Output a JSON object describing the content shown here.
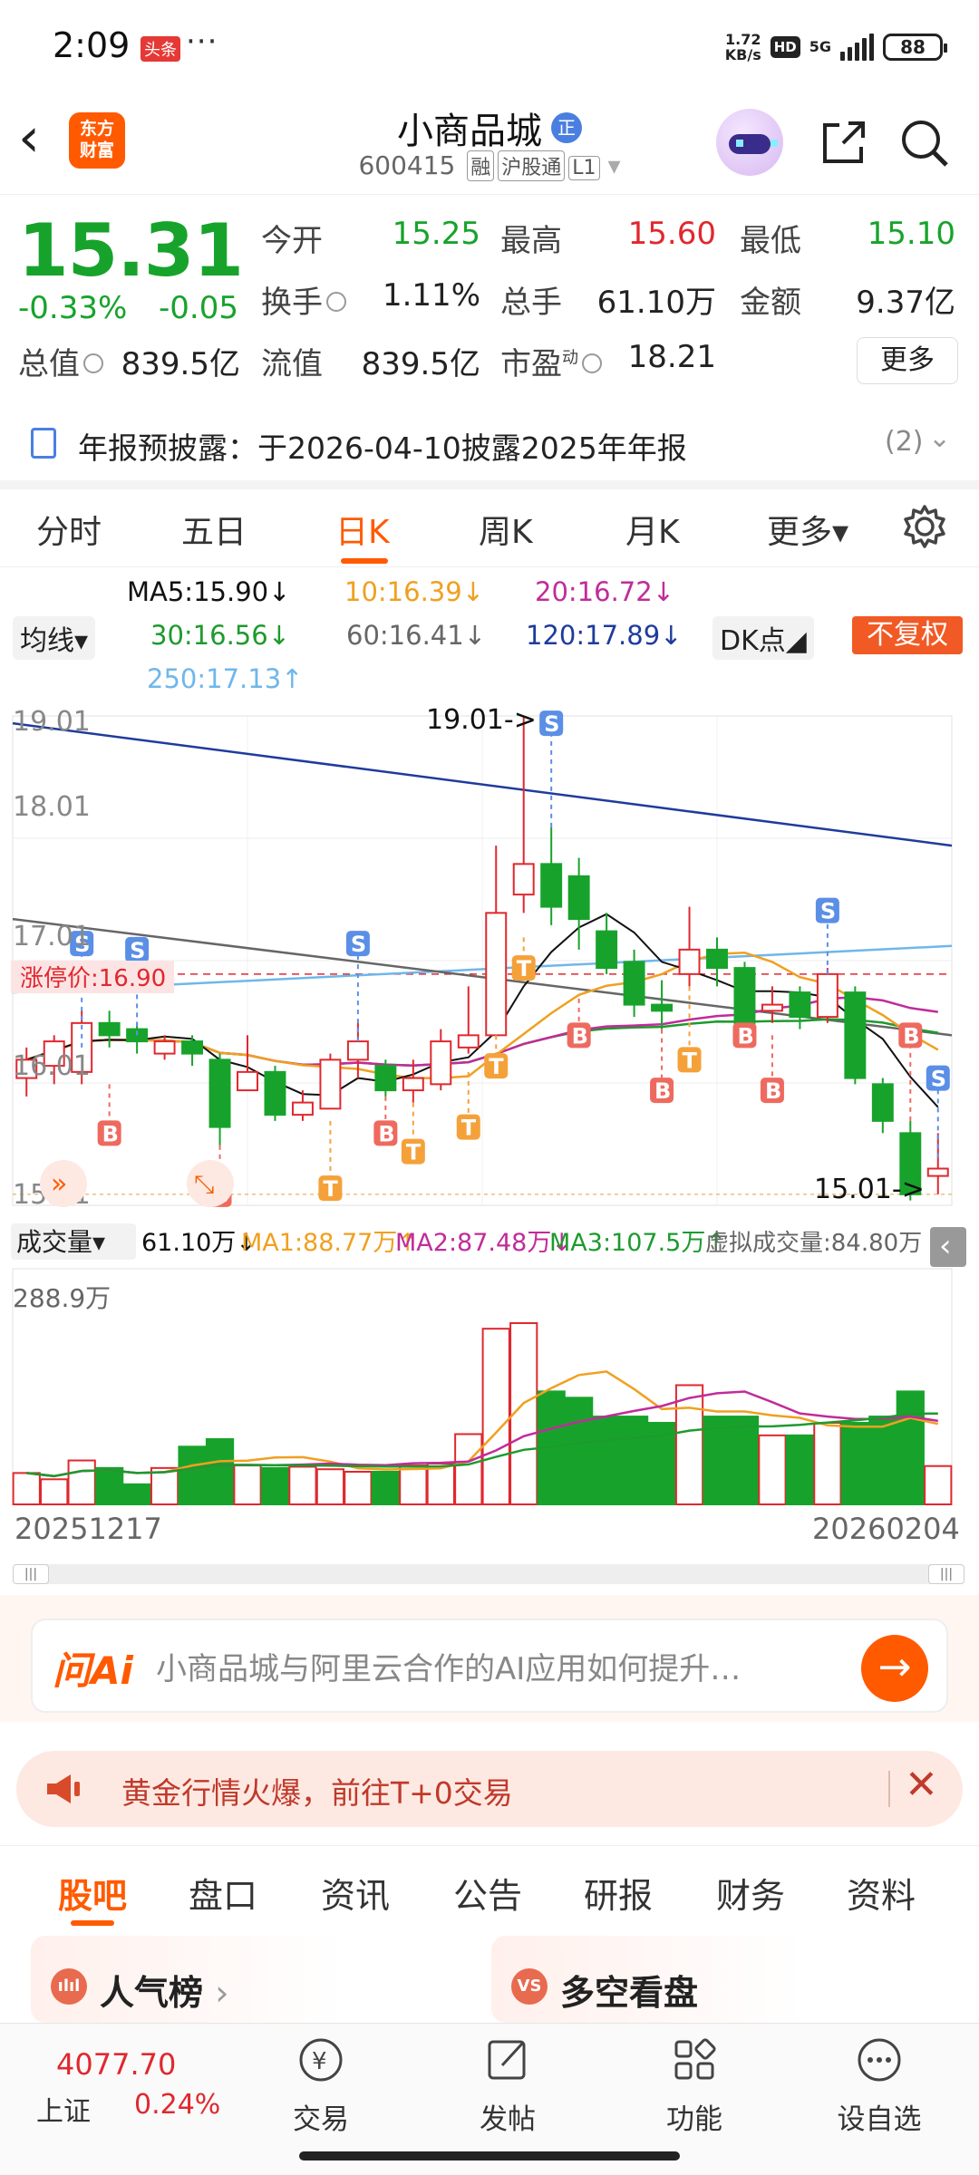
{
  "status_bar": {
    "time": "2:09",
    "app_badge": "头条",
    "dots": "···",
    "net_speed_value": "1.72",
    "net_speed_unit": "KB/s",
    "hd": "HD",
    "signal": "5G",
    "battery": "88"
  },
  "header": {
    "back": "‹",
    "logo_line1": "东方",
    "logo_line2": "财富",
    "stock_name": "小商品城",
    "name_badge": "正",
    "code": "600415",
    "tags": [
      "融",
      "沪股通",
      "L1"
    ],
    "dropdown": "▾"
  },
  "quote": {
    "price": "15.31",
    "change_pct": "-0.33%",
    "change": "-0.05",
    "open_label": "今开",
    "open": "15.25",
    "high_label": "最高",
    "high": "15.60",
    "low_label": "最低",
    "low": "15.10",
    "turnover_label": "换手",
    "turnover": "1.11%",
    "volume_label": "总手",
    "volume": "61.10万",
    "amount_label": "金额",
    "amount": "9.37亿",
    "mktcap_label": "总值",
    "mktcap": "839.5亿",
    "float_label": "流值",
    "float": "839.5亿",
    "pe_label": "市盈",
    "pe_sup": "动",
    "pe": "18.21",
    "more": "更多"
  },
  "notice": {
    "text": "年报预披露：于2026-04-10披露2025年年报",
    "count": "(2)",
    "chevron": "⌄"
  },
  "period_tabs": [
    "分时",
    "五日",
    "日K",
    "周K",
    "月K",
    "更多▾"
  ],
  "active_period": "日K",
  "ma": {
    "ma5": "MA5:15.90↓",
    "ma10": "10:16.39↓",
    "ma20": "20:16.72↓",
    "ma30": "30:16.56↓",
    "ma60": "60:16.41↓",
    "ma120": "120:17.89↓",
    "ma250": "250:17.13↑",
    "junxian": "均线▾",
    "dk": "DK点◢",
    "nofq": "不复权"
  },
  "colors": {
    "up": "#e0282e",
    "down": "#17a32b",
    "accent": "#ff5a00",
    "ma5": "#111111",
    "ma10": "#f0a020",
    "ma20": "#c02c9a",
    "ma30": "#1e9a2e",
    "ma60": "#666666",
    "ma120": "#1f3b9c",
    "ma250": "#6fb7ea"
  },
  "chart_labels": {
    "y_top": "19.01",
    "y_18": "18.01",
    "y_17": "17.01",
    "y_16": "16.01",
    "y_bottom": "15.01",
    "high_arrow": "19.01->",
    "low_arrow": "15.01->",
    "limit_price": "涨停价:16.90",
    "vol_title": "成交量▾",
    "vol_value": "61.10万↓",
    "vol_ma1": "MA1:88.77万↑",
    "vol_ma2": "MA2:87.48万↓",
    "vol_ma3": "MA3:107.5万↑",
    "vol_virtual": "虚拟成交量:84.80万",
    "vol_max": "288.9万",
    "date_start": "20251217",
    "date_end": "20260204",
    "collapse": "‹"
  },
  "chart_data": {
    "type": "candlestick",
    "x_start": "20251217",
    "x_end": "20260204",
    "ylim": [
      15.01,
      19.01
    ],
    "yticks": [
      "19.01",
      "18.01",
      "17.01",
      "16.01",
      "15.01"
    ],
    "candles": [
      {
        "o": 16.05,
        "c": 16.2,
        "h": 16.3,
        "l": 15.9
      },
      {
        "o": 16.15,
        "c": 16.35,
        "h": 16.4,
        "l": 16.0
      },
      {
        "o": 16.1,
        "c": 16.5,
        "h": 16.6,
        "l": 16.0
      },
      {
        "o": 16.5,
        "c": 16.4,
        "h": 16.6,
        "l": 16.3
      },
      {
        "o": 16.45,
        "c": 16.35,
        "h": 16.5,
        "l": 16.25
      },
      {
        "o": 16.25,
        "c": 16.35,
        "h": 16.4,
        "l": 16.2
      },
      {
        "o": 16.35,
        "c": 16.25,
        "h": 16.4,
        "l": 16.15
      },
      {
        "o": 16.2,
        "c": 15.65,
        "h": 16.25,
        "l": 15.5
      },
      {
        "o": 15.95,
        "c": 16.1,
        "h": 16.4,
        "l": 15.95
      },
      {
        "o": 16.1,
        "c": 15.75,
        "h": 16.15,
        "l": 15.7
      },
      {
        "o": 15.75,
        "c": 15.85,
        "h": 15.95,
        "l": 15.7
      },
      {
        "o": 15.8,
        "c": 16.2,
        "h": 16.25,
        "l": 15.8
      },
      {
        "o": 16.2,
        "c": 16.35,
        "h": 16.5,
        "l": 16.05
      },
      {
        "o": 16.15,
        "c": 15.95,
        "h": 16.2,
        "l": 15.9
      },
      {
        "o": 15.95,
        "c": 16.05,
        "h": 16.2,
        "l": 15.85
      },
      {
        "o": 16.0,
        "c": 16.35,
        "h": 16.45,
        "l": 15.95
      },
      {
        "o": 16.3,
        "c": 16.4,
        "h": 16.8,
        "l": 16.25
      },
      {
        "o": 16.4,
        "c": 17.4,
        "h": 17.95,
        "l": 16.4
      },
      {
        "o": 17.55,
        "c": 17.8,
        "h": 19.01,
        "l": 17.4
      },
      {
        "o": 17.8,
        "c": 17.45,
        "h": 18.1,
        "l": 17.3
      },
      {
        "o": 17.7,
        "c": 17.35,
        "h": 17.85,
        "l": 17.1
      },
      {
        "o": 17.25,
        "c": 16.95,
        "h": 17.4,
        "l": 16.9
      },
      {
        "o": 17.0,
        "c": 16.65,
        "h": 17.1,
        "l": 16.55
      },
      {
        "o": 16.65,
        "c": 16.6,
        "h": 16.85,
        "l": 16.45
      },
      {
        "o": 16.9,
        "c": 17.1,
        "h": 17.45,
        "l": 16.8
      },
      {
        "o": 17.1,
        "c": 16.95,
        "h": 17.2,
        "l": 16.8
      },
      {
        "o": 16.95,
        "c": 16.5,
        "h": 17.0,
        "l": 16.4
      },
      {
        "o": 16.6,
        "c": 16.65,
        "h": 16.8,
        "l": 16.5
      },
      {
        "o": 16.75,
        "c": 16.55,
        "h": 16.8,
        "l": 16.45
      },
      {
        "o": 16.55,
        "c": 16.9,
        "h": 16.95,
        "l": 16.5
      },
      {
        "o": 16.75,
        "c": 16.05,
        "h": 16.8,
        "l": 16.0
      },
      {
        "o": 16.0,
        "c": 15.7,
        "h": 16.05,
        "l": 15.6
      },
      {
        "o": 15.6,
        "c": 15.1,
        "h": 15.7,
        "l": 15.05
      },
      {
        "o": 15.25,
        "c": 15.31,
        "h": 15.6,
        "l": 15.1
      }
    ],
    "volume_ylim": [
      0,
      288.9
    ],
    "volume": [
      50,
      40,
      70,
      58,
      32,
      58,
      92,
      104,
      62,
      58,
      60,
      56,
      52,
      52,
      62,
      65,
      112,
      280,
      288.9,
      180,
      170,
      140,
      140,
      130,
      190,
      140,
      140,
      110,
      110,
      130,
      130,
      140,
      180,
      61.1
    ]
  },
  "scroll_handles": [
    "|||",
    "|||"
  ],
  "ai": {
    "logo": "问Ai",
    "question": "小商品城与阿里云合作的AI应用如何提升…",
    "go": "→"
  },
  "promo": {
    "text": "黄金行情火爆，前往T+0交易",
    "close": "✕"
  },
  "section_tabs": [
    "股吧",
    "盘口",
    "资讯",
    "公告",
    "研报",
    "财务",
    "资料"
  ],
  "active_section": "股吧",
  "cards": [
    {
      "icon": "ılıl",
      "title": "人气榜",
      "chev": "›"
    },
    {
      "icon": "VS",
      "title": "多空看盘",
      "chev": ""
    }
  ],
  "bottom": {
    "index_value": "4077.70",
    "index_name": "上证",
    "index_change": "0.24%",
    "nav": [
      "交易",
      "发帖",
      "功能",
      "设自选"
    ]
  }
}
